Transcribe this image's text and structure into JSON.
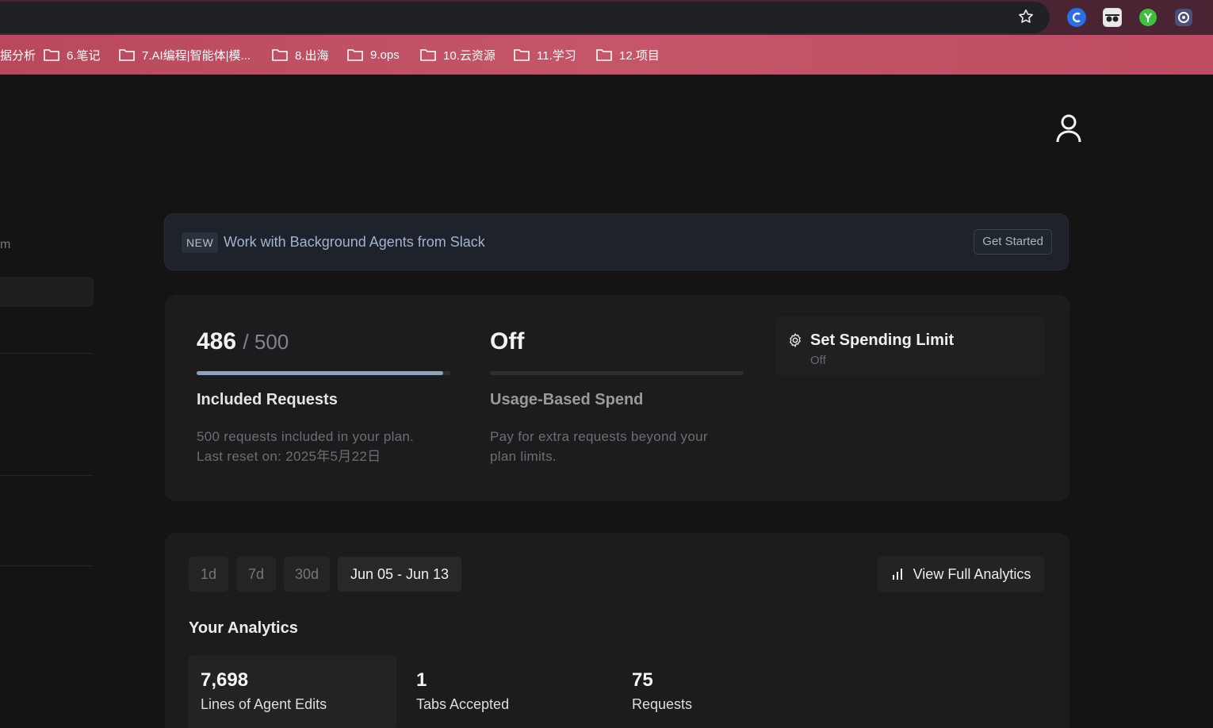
{
  "browser": {
    "bookmarks": [
      "据分析",
      "6.笔记",
      "7.AI编程|智能体|模...",
      "8.出海",
      "9.ops",
      "10.云资源",
      "11.学习",
      "12.项目"
    ],
    "colors": {
      "bookmark_bar": "#c5566a",
      "titlebar": "#4a2433"
    }
  },
  "sidebar": {
    "partial_text": "m"
  },
  "banner": {
    "badge": "NEW",
    "text": "Work with Background Agents from Slack",
    "button": "Get Started"
  },
  "usage": {
    "included": {
      "used": "486",
      "total": "/ 500",
      "progress_fraction": 0.972,
      "title": "Included Requests",
      "desc_line1": "500 requests included in your plan.",
      "desc_line2": "Last reset on: 2025年5月22日"
    },
    "usage_based": {
      "value": "Off",
      "progress_fraction": 0,
      "title": "Usage-Based Spend",
      "desc_line1": "Pay for extra requests beyond your",
      "desc_line2": "plan limits."
    },
    "spending_limit": {
      "title": "Set Spending Limit",
      "status": "Off",
      "icon": "gear-icon"
    }
  },
  "analytics": {
    "ranges": [
      "1d",
      "7d",
      "30d",
      "Jun 05 - Jun 13"
    ],
    "active_range": "Jun 05 - Jun 13",
    "view_button": "View Full Analytics",
    "title": "Your Analytics",
    "stats": [
      {
        "value": "7,698",
        "label": "Lines of Agent Edits"
      },
      {
        "value": "1",
        "label": "Tabs Accepted"
      },
      {
        "value": "75",
        "label": "Requests"
      }
    ]
  }
}
